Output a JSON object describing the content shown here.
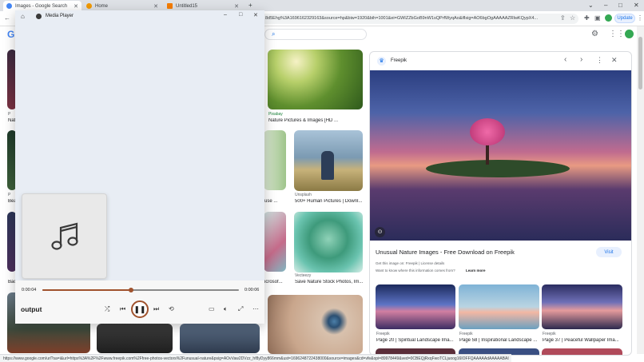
{
  "tabs": [
    {
      "title": "Images - Google Search",
      "active": true,
      "favicon_color": "#4285f4"
    },
    {
      "title": "Home",
      "active": false,
      "favicon_color": "#f29900"
    },
    {
      "title": "Untitled15",
      "active": false,
      "favicon_color": "#f57c00"
    }
  ],
  "new_tab_label": "+",
  "window_controls": {
    "minimize": "–",
    "maximize": "□",
    "close": "✕",
    "tab_search": "⌄"
  },
  "toolbar": {
    "back_icon": "arrow-left-icon",
    "url": "8d5Ehg%3A1696162329163&source=hp&biw=1920&bih=1001&ei=GWIZZbGoB9nW1sQPrfWyqAo&iflsig=AO6bgOgAAAAAZRlwKQypX4...",
    "update_label": "Update"
  },
  "google": {
    "logo_letter": "G",
    "search_icon": "search-icon"
  },
  "results": [
    {
      "source": "P",
      "title": "Nat"
    },
    {
      "source": "P",
      "title": "Bea"
    },
    {
      "source": "",
      "title": "Bac"
    },
    {
      "source": "Pixabay",
      "title": "Nature Pictures & Images [HD ..."
    },
    {
      "source": "",
      "title": "use ..."
    },
    {
      "source": "Unsplash",
      "title": "500+ Human Pictures | Downl..."
    },
    {
      "source": "",
      "title": "icrosof..."
    },
    {
      "source": "Vecteezy",
      "title": "Save Nature Stock Photos, Im..."
    }
  ],
  "panel": {
    "source_name": "Freepik",
    "title": "Unusual Nature Images - Free Download on Freepik",
    "visit_label": "Visit",
    "info_line": "Get this image on: Freepik | License details",
    "info_link_label": "Freepik | License details",
    "know_line": "Want to know where this information comes from?",
    "learn_more": "Learn more",
    "related": [
      {
        "source": "Freepik",
        "title": "Page 20 | Spiritual Landscape Ima..."
      },
      {
        "source": "Freepik",
        "title": "Page 58 | Inspirational Landscape ..."
      },
      {
        "source": "Freepik",
        "title": "Page 37 | Peaceful Wallpaper Ima..."
      }
    ]
  },
  "status_url": "https://www.google.com/url?sa=i&url=https%3A%2F%2Fwww.freepik.com%2Ffree-photos-vectors%2Funusual-nature&psig=AOvVaw2DVzz_hf8yDyy866mm&ust=1696248722438000&source=images&cd=vfe&opi=89978449&ved=0CBEQjRxqFwoTCLjuoog16IOFFQAAAAAdAAAAABAI",
  "media_player": {
    "window_title": "Media Player",
    "home_icon": "home-icon",
    "current_time": "0:00:04",
    "total_time": "0:00:06",
    "progress": 0.45,
    "track_title": "output",
    "accent": "#a0522d"
  }
}
